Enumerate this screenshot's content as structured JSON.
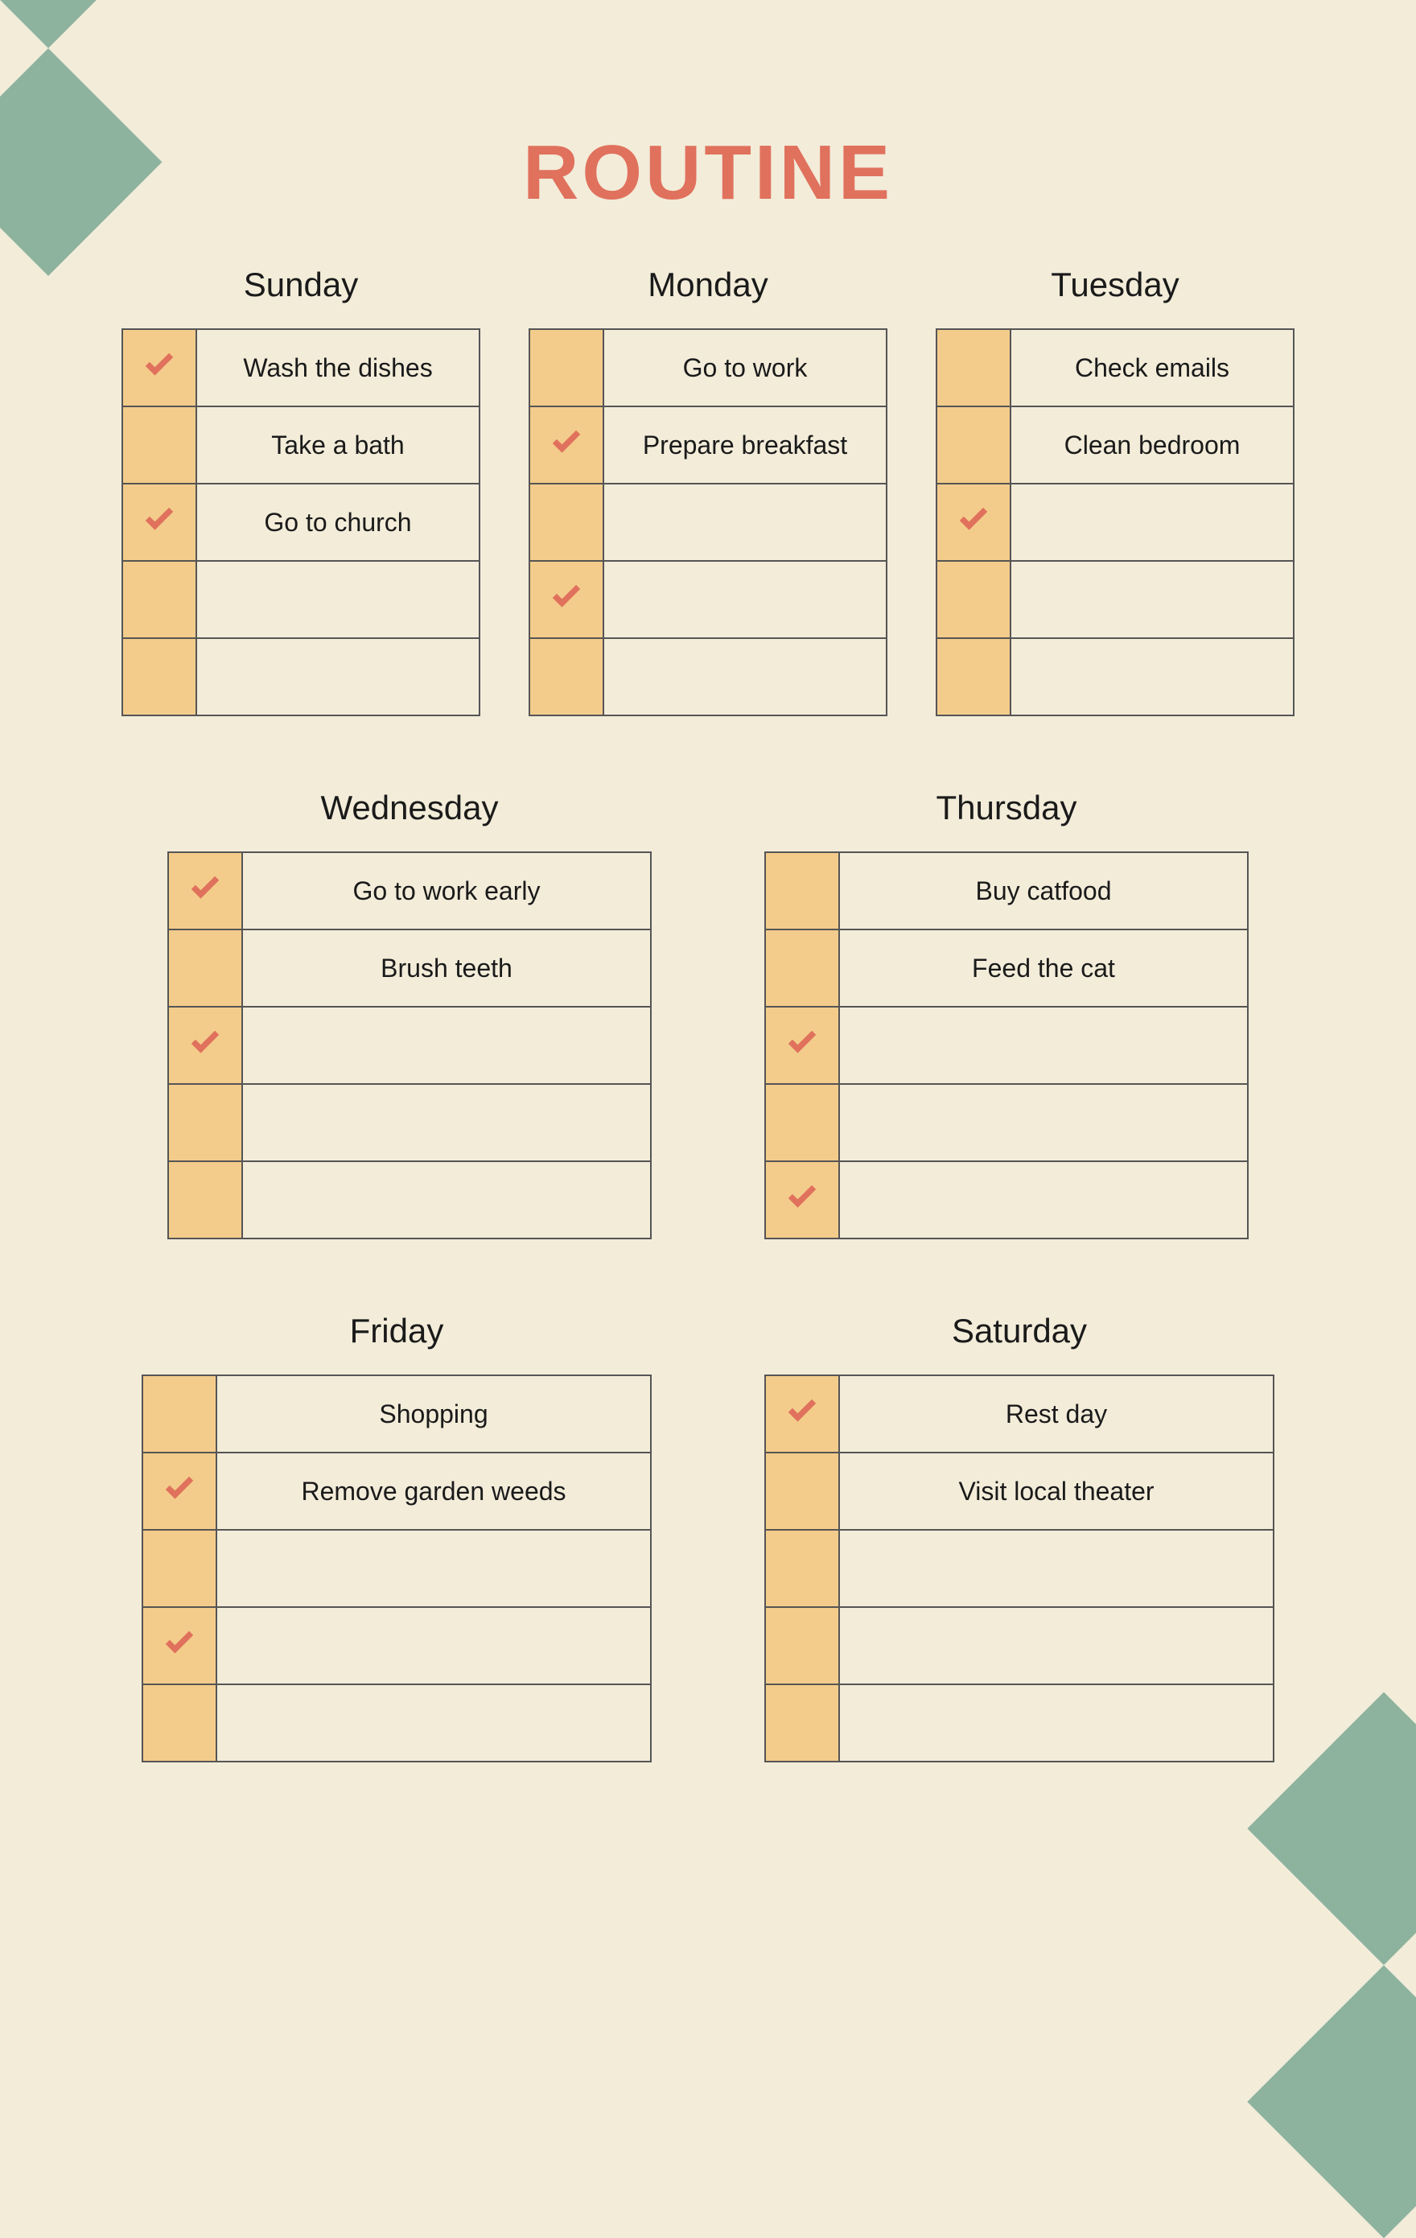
{
  "title": "ROUTINE",
  "days": [
    {
      "name": "Sunday",
      "size": 0,
      "rows": [
        {
          "done": true,
          "text": "Wash the dishes"
        },
        {
          "done": false,
          "text": "Take a bath"
        },
        {
          "done": true,
          "text": "Go to church"
        },
        {
          "done": false,
          "text": ""
        },
        {
          "done": false,
          "text": ""
        }
      ]
    },
    {
      "name": "Monday",
      "size": 0,
      "rows": [
        {
          "done": false,
          "text": "Go to work"
        },
        {
          "done": true,
          "text": "Prepare breakfast"
        },
        {
          "done": false,
          "text": ""
        },
        {
          "done": true,
          "text": ""
        },
        {
          "done": false,
          "text": ""
        }
      ]
    },
    {
      "name": "Tuesday",
      "size": 0,
      "rows": [
        {
          "done": false,
          "text": "Check emails"
        },
        {
          "done": false,
          "text": "Clean bedroom"
        },
        {
          "done": true,
          "text": ""
        },
        {
          "done": false,
          "text": ""
        },
        {
          "done": false,
          "text": ""
        }
      ]
    },
    {
      "name": "Wednesday",
      "size": 1,
      "rows": [
        {
          "done": true,
          "text": "Go to work early"
        },
        {
          "done": false,
          "text": "Brush teeth"
        },
        {
          "done": true,
          "text": ""
        },
        {
          "done": false,
          "text": ""
        },
        {
          "done": false,
          "text": ""
        }
      ]
    },
    {
      "name": "Thursday",
      "size": 1,
      "rows": [
        {
          "done": false,
          "text": "Buy catfood"
        },
        {
          "done": false,
          "text": "Feed the cat"
        },
        {
          "done": true,
          "text": ""
        },
        {
          "done": false,
          "text": ""
        },
        {
          "done": true,
          "text": ""
        }
      ]
    },
    {
      "name": "Friday",
      "size": 2,
      "rows": [
        {
          "done": false,
          "text": "Shopping"
        },
        {
          "done": true,
          "text": "Remove garden weeds"
        },
        {
          "done": false,
          "text": ""
        },
        {
          "done": true,
          "text": ""
        },
        {
          "done": false,
          "text": ""
        }
      ]
    },
    {
      "name": "Saturday",
      "size": 2,
      "rows": [
        {
          "done": true,
          "text": "Rest day"
        },
        {
          "done": false,
          "text": "Visit local theater"
        },
        {
          "done": false,
          "text": ""
        },
        {
          "done": false,
          "text": ""
        },
        {
          "done": false,
          "text": ""
        }
      ]
    }
  ]
}
